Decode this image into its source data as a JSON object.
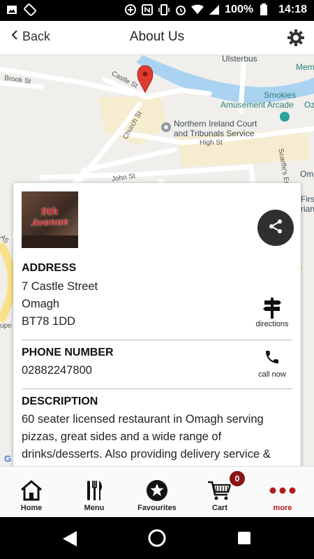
{
  "status_bar": {
    "battery": "100%",
    "time": "14:18"
  },
  "header": {
    "back_label": "Back",
    "title": "About Us"
  },
  "map": {
    "labels": {
      "ulsterbus": "Ulsterbus",
      "mem": "Mem",
      "brook_st": "Brook St",
      "castle_st": "Castle St",
      "smokies1": "Smokies",
      "smokies2": "Amusement Arcade",
      "oz": "Oz",
      "court1": "Northern Ireland Court",
      "court2": "and Tribunals Service",
      "church_st": "Church St",
      "high_st": "High St",
      "scarffes": "Scarffe's Entry",
      "oma": "Oma",
      "john_st": "John St",
      "first": "First",
      "rian": "rian",
      "a5": "A5",
      "upe": "upe",
      "g": "G"
    }
  },
  "card": {
    "thumbnail_logo": "9th Avenue",
    "address": {
      "title": "ADDRESS",
      "line1": "7 Castle Street",
      "line2": "Omagh",
      "line3": "BT78 1DD",
      "action_label": "directions"
    },
    "phone": {
      "title": "PHONE NUMBER",
      "number": "02882247800",
      "action_label": "call now"
    },
    "description": {
      "title": "DESCRIPTION",
      "line1": "60 seater licensed restaurant in Omagh serving",
      "line2": "pizzas, great sides and a wide range of",
      "line3": "drinks/desserts. Also providing delivery service &"
    }
  },
  "tabbar": {
    "home": "Home",
    "menu": "Menu",
    "favourites": "Favourites",
    "cart": "Cart",
    "cart_count": "0",
    "more": "more"
  },
  "colors": {
    "accent": "#b01c1c",
    "badge": "#8b1414",
    "river": "#a9d3f0"
  }
}
